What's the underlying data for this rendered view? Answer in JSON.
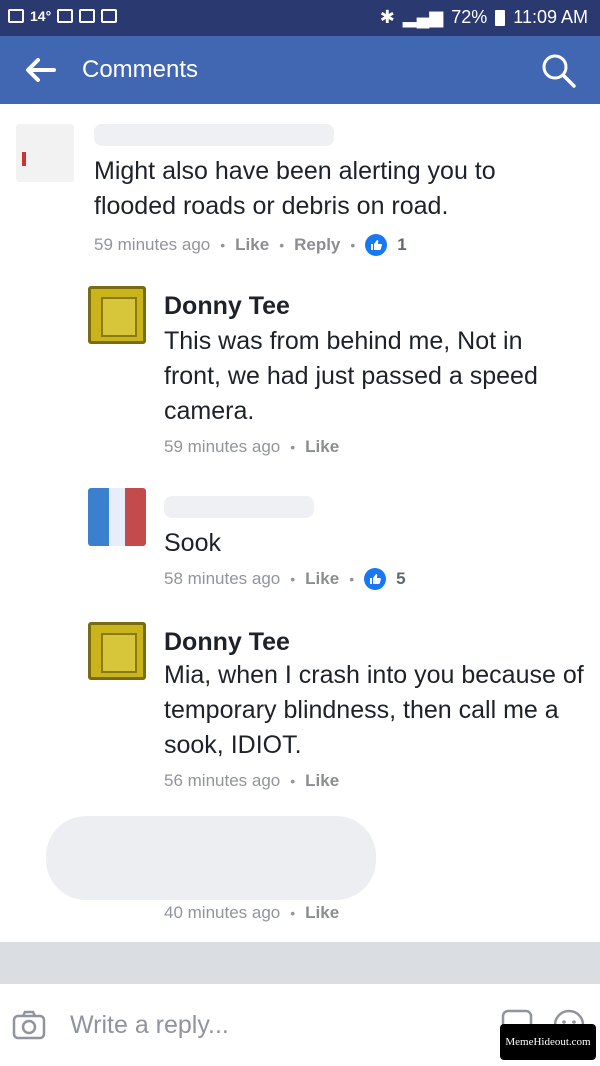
{
  "status_bar": {
    "left_text": "14°",
    "battery": "72%",
    "time": "11:09 AM"
  },
  "app_bar": {
    "title": "Comments",
    "back_icon": "arrow-left-icon",
    "search_icon": "search-icon"
  },
  "comments": [
    {
      "author": "",
      "text": "Might also have been alerting you to flooded roads or debris on road.",
      "time": "59 minutes ago",
      "like_label": "Like",
      "reply_label": "Reply",
      "reactions": "1"
    },
    {
      "author": "Donny Tee",
      "text": "This was from behind me, Not in front, we had just passed a speed camera.",
      "time": "59 minutes ago",
      "like_label": "Like"
    },
    {
      "author": "",
      "text": "Sook",
      "time": "58 minutes ago",
      "like_label": "Like",
      "reactions": "5"
    },
    {
      "author": "Donny Tee",
      "text": "Mia, when I crash into you because of temporary blindness, then call me a sook, IDIOT.",
      "time": "56 minutes ago",
      "like_label": "Like"
    },
    {
      "author": "",
      "text": "",
      "time": "40 minutes ago",
      "like_label": "Like"
    }
  ],
  "reply_bar": {
    "placeholder": "Write a reply..."
  },
  "watermark": "MemeHideout.com",
  "colors": {
    "status_bar": "#2a3a70",
    "app_bar": "#4267b2",
    "like_badge": "#1877f2"
  }
}
